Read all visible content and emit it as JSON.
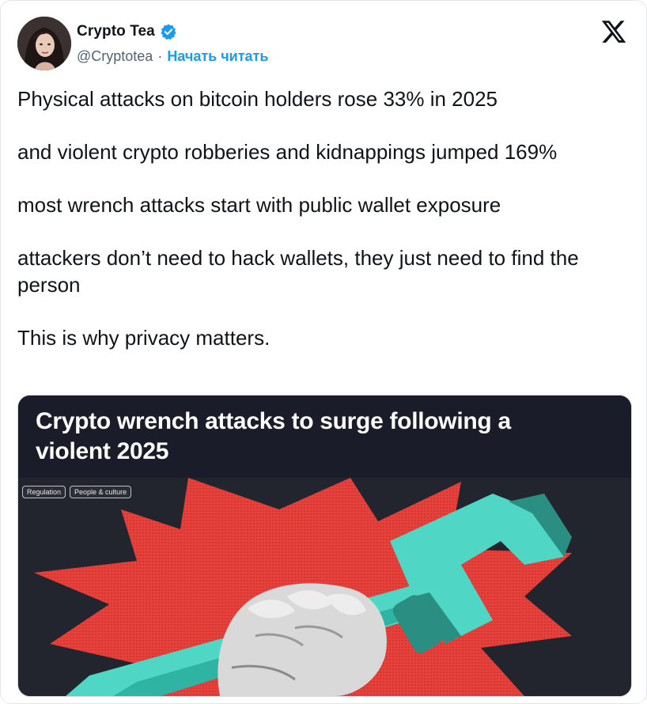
{
  "author": {
    "name": "Crypto Tea",
    "handle": "@Cryptotea",
    "separator": "·",
    "follow_label": "Начать читать"
  },
  "icons": {
    "verified": "verified-badge-icon",
    "platform": "x-logo-icon"
  },
  "tweet": {
    "paragraphs": [
      "Physical attacks on bitcoin holders rose 33% in 2025",
      "and violent crypto robberies and kidnappings jumped 169%",
      "most wrench attacks start with public wallet exposure",
      "attackers don’t need to hack wallets, they just need to find the person",
      "This is why privacy matters."
    ]
  },
  "media": {
    "title": "Crypto wrench attacks to surge following a violent 2025",
    "tags": [
      "Regulation",
      "People & culture"
    ]
  },
  "colors": {
    "accent": "#1d9bf0",
    "verified": "#1d9bf0",
    "media_header": "#1a1d29",
    "media_bg": "#22252e",
    "burst": "#e8403a",
    "wrench": "#4fd6c4",
    "wrench_dark": "#2a8f82"
  }
}
